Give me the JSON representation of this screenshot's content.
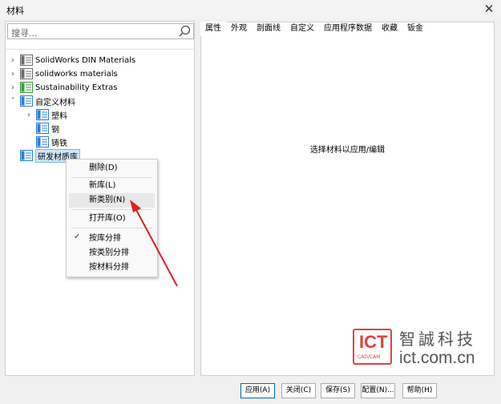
{
  "window": {
    "title": "材料",
    "close_glyph": "✕"
  },
  "search": {
    "placeholder": "搜寻..."
  },
  "tree": [
    {
      "label": "SolidWorks DIN Materials",
      "twisty": "›",
      "icon_color": "#6b6b6b",
      "level": 0
    },
    {
      "label": "solidworks materials",
      "twisty": "›",
      "icon_color": "#6b6b6b",
      "level": 0
    },
    {
      "label": "Sustainability Extras",
      "twisty": "›",
      "icon_color": "#3a9c3a",
      "level": 0
    },
    {
      "label": "自定义材料",
      "twisty": "˅",
      "icon_color": "#2a7fd4",
      "level": 0
    },
    {
      "label": "塑料",
      "twisty": "›",
      "icon_color": "#2a7fd4",
      "level": 1
    },
    {
      "label": "钢",
      "twisty": "",
      "icon_color": "#2a7fd4",
      "level": 1
    },
    {
      "label": "铸铁",
      "twisty": "",
      "icon_color": "#2a7fd4",
      "level": 1
    },
    {
      "label": "研发材质库",
      "twisty": "",
      "icon_color": "#2a7fd4",
      "level": 0,
      "selected": true
    }
  ],
  "tabs": [
    "属性",
    "外观",
    "剖面线",
    "自定义",
    "应用程序数据",
    "收藏",
    "钣金"
  ],
  "main": {
    "message": "选择材料以应用/编辑"
  },
  "context_menu": {
    "items": [
      {
        "label": "删除(D)"
      },
      {
        "label": "新库(L)"
      },
      {
        "label": "新类别(N)",
        "hover": true
      },
      {
        "label": "打开库(O)"
      },
      {
        "label": "按库分排",
        "checked": true
      },
      {
        "label": "按类别分排"
      },
      {
        "label": "按材料分排"
      }
    ]
  },
  "buttons": {
    "apply": "应用(A)",
    "close": "关闭(C)",
    "save": "保存(S)",
    "config": "配置(N)...",
    "help": "帮助(H)"
  },
  "watermark": {
    "logo": "ICT",
    "logo_sub": "CAD/CAM",
    "brand_cn": "智誠科技",
    "url": "ict.com.cn"
  },
  "colors": {
    "accent": "#0067c0",
    "arrow": "#e02020",
    "folder_blue": "#2a7fd4"
  }
}
